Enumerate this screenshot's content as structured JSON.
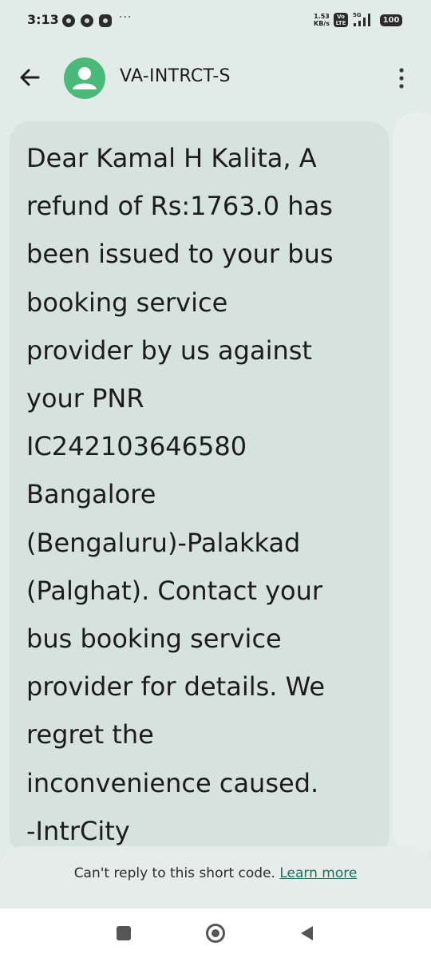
{
  "status_bar": {
    "time": "3:13",
    "more": "···",
    "net_speed_value": "1.53",
    "net_speed_unit": "KB/s",
    "volte_top": "Vo",
    "volte_bottom": "LTE",
    "battery": "100"
  },
  "app_bar": {
    "contact_name": "VA-INTRCT-S"
  },
  "message": {
    "text": "Dear Kamal H Kalita, A\nrefund of Rs:1763.0 has\nbeen issued to your bus\nbooking service\nprovider by us against\nyour PNR\nIC242103646580\nBangalore\n(Bengaluru)-Palakkad\n(Palghat). Contact your\nbus booking service\nprovider for details. We\nregret the\ninconvenience caused.\n-IntrCity"
  },
  "footer": {
    "notice": "Can't reply to this short code.",
    "learn_more": "Learn more"
  },
  "colors": {
    "background": "#e1ebe7",
    "bubble": "#d6e2dd",
    "avatar": "#4bb97a",
    "link": "#1e6e57"
  },
  "icons": [
    "back-arrow-icon",
    "person-icon",
    "more-vert-icon",
    "recent-apps-icon",
    "home-icon",
    "nav-back-icon"
  ]
}
